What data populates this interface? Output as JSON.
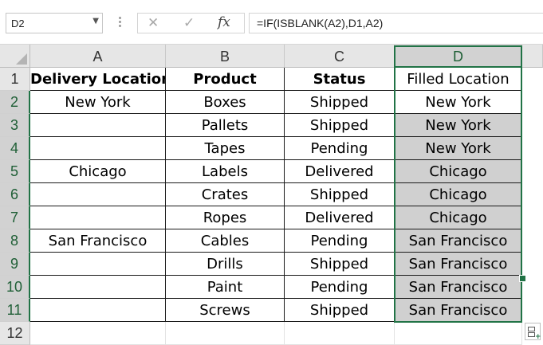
{
  "formula_bar": {
    "name_box": "D2",
    "cancel_icon": "✕",
    "enter_icon": "✓",
    "fx_label": "fx",
    "formula": "=IF(ISBLANK(A2),D1,A2)"
  },
  "columns": [
    "A",
    "B",
    "C",
    "D"
  ],
  "rows": [
    "1",
    "2",
    "3",
    "4",
    "5",
    "6",
    "7",
    "8",
    "9",
    "10",
    "11",
    "12"
  ],
  "header_row": [
    "Delivery Location",
    "Product",
    "Status",
    "Filled Location"
  ],
  "data_rows": [
    [
      "New York",
      "Boxes",
      "Shipped",
      "New York"
    ],
    [
      "",
      "Pallets",
      "Shipped",
      "New York"
    ],
    [
      "",
      "Tapes",
      "Pending",
      "New York"
    ],
    [
      "Chicago",
      "Labels",
      "Delivered",
      "Chicago"
    ],
    [
      "",
      "Crates",
      "Shipped",
      "Chicago"
    ],
    [
      "",
      "Ropes",
      "Delivered",
      "Chicago"
    ],
    [
      "San Francisco",
      "Cables",
      "Pending",
      "San Francisco"
    ],
    [
      "",
      "Drills",
      "Shipped",
      "San Francisco"
    ],
    [
      "",
      "Paint",
      "Pending",
      "San Francisco"
    ],
    [
      "",
      "Screws",
      "Shipped",
      "San Francisco"
    ]
  ],
  "colors": {
    "selection": "#217346",
    "filled_cell_bg": "#d0d0d0",
    "header_bg": "#e6e6e6"
  },
  "icons": {
    "quick_analysis": "quick-analysis-icon",
    "corner": "select-all-icon"
  }
}
